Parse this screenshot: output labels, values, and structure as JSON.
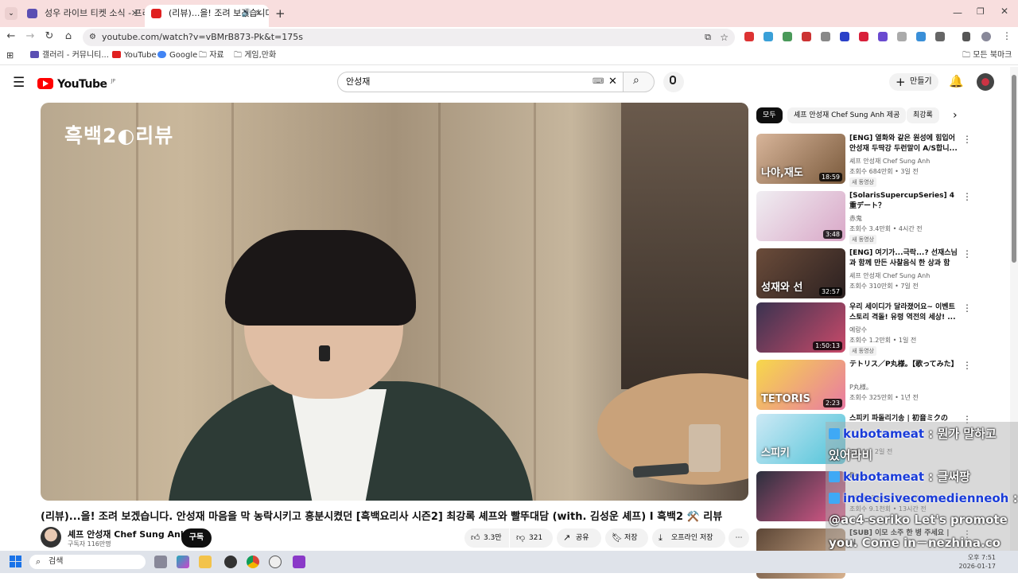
{
  "browser": {
    "tabs": [
      {
        "label": "성우 라이브 티켓 소식 - 프리미"
      },
      {
        "label": "(리뷰)...을! 조려 보겠습니다"
      }
    ],
    "url": "youtube.com/watch?v=vBMrB873-Pk&t=175s",
    "bookmarks": [
      "갤러리 - 커뮤니티...",
      "YouTube",
      "Google",
      "자료",
      "게임,만화"
    ],
    "all_bookmarks": "모든 북마크"
  },
  "youtube": {
    "logo": "YouTube",
    "region": "JP",
    "search_value": "안성재",
    "create_label": "만들기"
  },
  "video": {
    "overlay_logo": "흑백2◐리뷰",
    "title": "(리뷰)...을! 조려 보겠습니다. 안성재 마음을 막 농락시키고 흥분시켰던 [흑백요리사 시즌2] 최강록 셰프와 빨뚜대담 (with. 김성운 셰프) I 흑백2 ⚒️ 리뷰",
    "channel": "셰프 안성재 Chef Sung Anh",
    "subscribers": "구독자 116만명",
    "subscribe_label": "구독",
    "likes": "3.3만",
    "dislikes": "321",
    "share": "공유",
    "save": "저장",
    "offline_save": "오프라인 저장",
    "more": "⋯"
  },
  "chips": [
    "모두",
    "셰프 안성재 Chef Sung Anh 제공",
    "최강록"
  ],
  "recommendations": [
    {
      "title": "[ENG] 열화와 같은 원성에 힘입어 안성재 두딱강 두런말이 A/S합니...",
      "channel": "셰프 안성재 Chef Sung Anh",
      "meta": "조회수 684만회 • 3일 전",
      "badge": "새 동영상",
      "duration": "18:59",
      "thumb_text": "나야,재도",
      "colors": [
        "#d8b59a",
        "#7a5a3c"
      ]
    },
    {
      "title": "[SolarisSupercupSeries] 4重デート？",
      "channel": "赤鬼",
      "meta": "조회수 3.4만회 • 4시간 전",
      "badge": "새 동영상",
      "duration": "3:48",
      "thumb_text": "",
      "colors": [
        "#f0eef2",
        "#d9a7c7"
      ]
    },
    {
      "title": "[ENG] 여기가...극락...? 선재스님과 함께 만든 사찰음식 한 상과 함께...",
      "channel": "셰프 안성재 Chef Sung Anh",
      "meta": "조회수 310만회 • 7일 전",
      "badge": "",
      "duration": "32:57",
      "thumb_text": "성재와 선",
      "colors": [
        "#6b4c3a",
        "#2b2020"
      ]
    },
    {
      "title": "우리 세이디가 달라졌어요~ 이벤트 스토리 격돌! 유령 역전의 세상! ...",
      "channel": "예랑수",
      "meta": "조회수 1.2만회 • 1일 전",
      "badge": "새 동영상",
      "duration": "1:50:13",
      "thumb_text": "",
      "colors": [
        "#3a3350",
        "#c94a6a"
      ]
    },
    {
      "title": "テトリス／P丸様。【歌ってみた】",
      "channel": "P丸様。",
      "meta": "조회수 325만회 • 1년 전",
      "badge": "",
      "duration": "2:23",
      "thumb_text": "TETORIS",
      "colors": [
        "#f7d84a",
        "#e87aa3"
      ]
    },
    {
      "title": "스피키 파돌리기송 | 初音ミクの",
      "channel": "",
      "meta": "조회수 • 2일 전",
      "badge": "",
      "duration": "",
      "thumb_text": "스피키",
      "colors": [
        "#cde9f5",
        "#4fc3d8"
      ]
    },
    {
      "title": "Bes",
      "channel": "M0W1 Deadly Assault - New ...",
      "meta": "조회수 9.1천회 • 13시간 전",
      "badge": "",
      "duration": "",
      "thumb_text": "",
      "colors": [
        "#2b2f3d",
        "#e05a8a"
      ]
    },
    {
      "title": "[SUB] 이모 소주 한 병 주세요 | 식",
      "channel": "",
      "meta": "",
      "badge": "",
      "duration": "",
      "thumb_text": "",
      "colors": [
        "#5c4636",
        "#d8b28f"
      ]
    }
  ],
  "chat": [
    {
      "name": "kubotameat",
      "text": ": 뭔가 말하고"
    },
    {
      "name": "",
      "text": "있어라비"
    },
    {
      "name": "kubotameat",
      "text": ": 글써팡"
    },
    {
      "name": "indecisivecomedienneoh",
      "text": ":"
    },
    {
      "name": "",
      "text": "@ac4-seriko Let's promote"
    },
    {
      "name": "",
      "text": "you. Come in－nezhina.co"
    },
    {
      "name": "",
      "text": "m"
    }
  ],
  "taskbar": {
    "search_label": "검색",
    "time": "오후 7:51",
    "date": "2026-01-17"
  }
}
